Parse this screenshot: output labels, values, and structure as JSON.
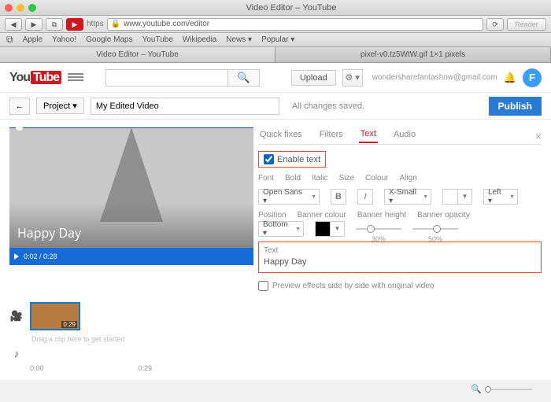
{
  "window": {
    "title": "Video Editor – YouTube"
  },
  "browser": {
    "url": "www.youtube.com/editor",
    "reader": "Reader",
    "bookmarks": [
      "Apple",
      "Yahoo!",
      "Google Maps",
      "YouTube",
      "Wikipedia",
      "News ▾",
      "Popular ▾"
    ],
    "tabs": [
      "Video Editor – YouTube",
      "pixel-v0.tz5WtW.gif 1×1 pixels"
    ]
  },
  "yt": {
    "logo1": "You",
    "logo2": "Tube",
    "upload": "Upload",
    "email": "wondersharefantashow@gmail.com",
    "avatar": "F"
  },
  "project": {
    "back": "←",
    "label": "Project  ▾",
    "title": "My Edited Video",
    "status": "All changes saved.",
    "publish": "Publish"
  },
  "preview": {
    "overlay": "Happy Day",
    "time": "0:02 / 0:28"
  },
  "tabs": {
    "quick": "Quick fixes",
    "filters": "Filters",
    "text": "Text",
    "audio": "Audio"
  },
  "text_panel": {
    "enable": "Enable text",
    "font_label": "Font",
    "font_value": "Open Sans ▾",
    "bold_label": "Bold",
    "bold": "B",
    "italic_label": "Italic",
    "italic": "I",
    "size_label": "Size",
    "size_value": "X-Small ▾",
    "colour_label": "Colour",
    "align_label": "Align",
    "align_value": "Left ▾",
    "position_label": "Position",
    "position_value": "Bottom ▾",
    "banner_colour_label": "Banner colour",
    "banner_height_label": "Banner height",
    "banner_height_value": "30%",
    "banner_opacity_label": "Banner opacity",
    "banner_opacity_value": "50%",
    "text_label": "Text",
    "text_value": "Happy Day",
    "sidebyside": "Preview effects side by side with original video"
  },
  "timeline": {
    "clip_duration": "0:29",
    "drop_hint": "Drag a clip here to get started",
    "ruler_start": "0:00",
    "ruler_end": "0:29"
  }
}
